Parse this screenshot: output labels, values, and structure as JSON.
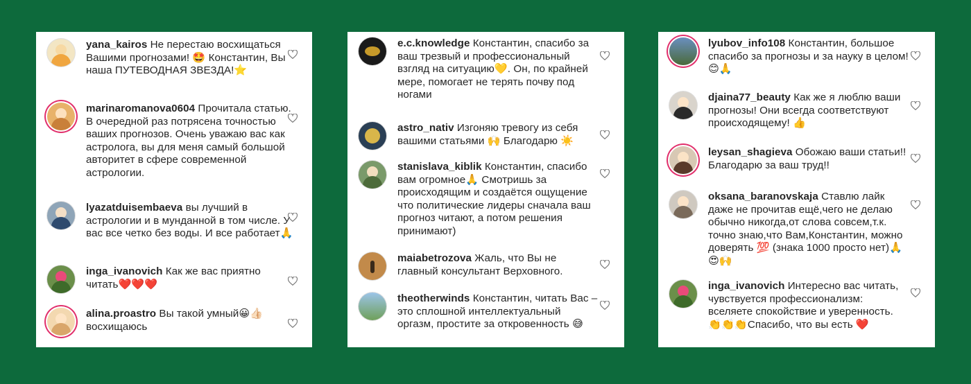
{
  "panels": [
    {
      "comments": [
        {
          "username": "yana_kairos",
          "text": "Не перестаю восхищаться Вашими прогнозами! 🤩 Константин,  Вы наша ПУТЕВОДНАЯ ЗВЕЗДА!⭐"
        },
        {
          "username": "marinaromanova0604",
          "text": "Прочитала статью. В очередной раз потрясена точностью ваших прогнозов. Очень уважаю вас как астролога, вы для меня самый большой авторитет в сфере современной астрологии."
        },
        {
          "username": "lyazatduisembaeva",
          "text": "вы лучший в астрологии и в мунданной в том числе. У вас все четко без воды. И все работает🙏"
        },
        {
          "username": "inga_ivanovich",
          "text": "Как же вас приятно читать❤️❤️❤️"
        },
        {
          "username": "alina.proastro",
          "text": "Вы такой умный😀👍🏻 восхищаюсь"
        }
      ]
    },
    {
      "comments": [
        {
          "username": "e.c.knowledge",
          "text": "Константин, спасибо за ваш трезвый и профессиональный взгляд на ситуацию💛. Он, по крайней мере, помогает не терять почву под ногами"
        },
        {
          "username": "astro_nativ",
          "text": "Изгоняю тревогу из себя вашими статьями 🙌 Благодарю ☀️"
        },
        {
          "username": "stanislava_kiblik",
          "text": "Константин, спасибо вам огромное🙏 Смотришь за происходящим и создаётся ощущение что политические лидеры сначала ваш прогноз читают, а потом решения принимают)"
        },
        {
          "username": "maiabetrozova",
          "text": "Жаль, что Вы не главный консультант Верховного."
        },
        {
          "username": "theotherwinds",
          "text": "Константин, читать Вас – это сплошной интеллектуальный оргазм, простите за откровенность 😅"
        }
      ]
    },
    {
      "comments": [
        {
          "username": "lyubov_info108",
          "text": "Константин, большое спасибо за прогнозы и за науку в целом! 😊🙏"
        },
        {
          "username": "djaina77_beauty",
          "text": "Как же я люблю ваши прогнозы! Они всегда соответствуют происходящему! 👍"
        },
        {
          "username": "leysan_shagieva",
          "text": "Обожаю ваши статьи!! Благодарю за ваш труд!!"
        },
        {
          "username": "oksana_baranovskaja",
          "text": "Ставлю лайк даже не прочитав ещё,чего не делаю обычно никогда,от слова совсем,т.к. точно знаю,что Вам,Константин, можно доверять 💯 (знака 1000 просто нет)🙏😍🙌"
        },
        {
          "username": "inga_ivanovich",
          "text": "Интересно вас читать, чувствуется профессионализм: вселяете спокойствие и уверенность. 👏👏👏Спасибо, что вы есть ❤️"
        }
      ]
    }
  ],
  "icons": {
    "like": "heart-outline-icon"
  },
  "colors": {
    "background": "#0d6a3c",
    "text": "#262626",
    "story_ring": "#e1306c"
  }
}
